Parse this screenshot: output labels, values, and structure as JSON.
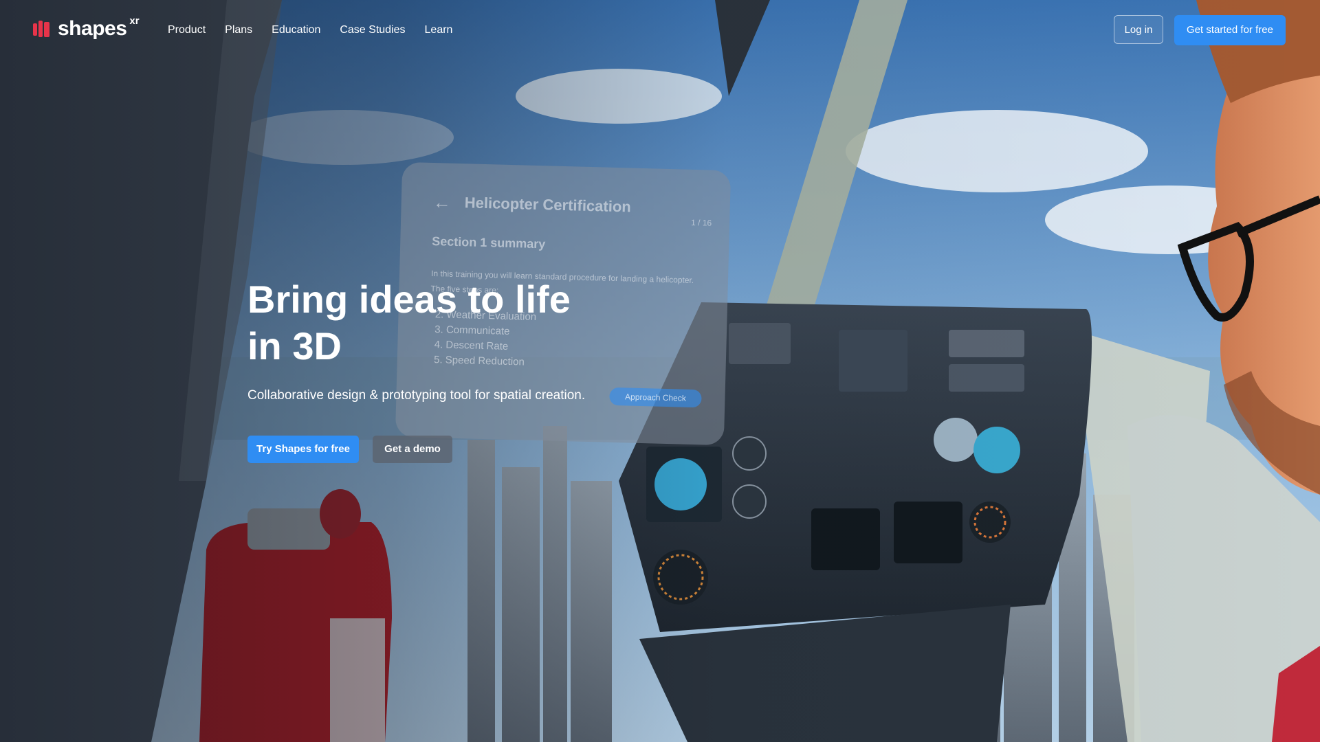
{
  "header": {
    "logo_text": "shapes",
    "logo_sup": "xr",
    "nav": [
      {
        "label": "Product"
      },
      {
        "label": "Plans"
      },
      {
        "label": "Education"
      },
      {
        "label": "Case Studies"
      },
      {
        "label": "Learn"
      }
    ],
    "login_label": "Log in",
    "cta_label": "Get started for free"
  },
  "hero": {
    "title_line1": "Bring ideas to life",
    "title_line2": "in 3D",
    "subtitle": "Collaborative design & prototyping tool for spatial creation.",
    "primary_cta": "Try Shapes for free",
    "secondary_cta": "Get a demo"
  },
  "scene_panel": {
    "back_icon": "arrow-left-icon",
    "title": "Helicopter Certification",
    "count": "1 / 16",
    "section": "Section 1 summary",
    "intro": "In this training you will learn standard procedure for landing a helicopter. The five steps are:",
    "steps": [
      "Weather Evaluation",
      "Communicate",
      "Descent Rate",
      "Speed Reduction"
    ],
    "chip": "Approach Check"
  },
  "colors": {
    "accent": "#2f8df3",
    "logo_red": "#e8344a",
    "text": "#ffffff"
  }
}
